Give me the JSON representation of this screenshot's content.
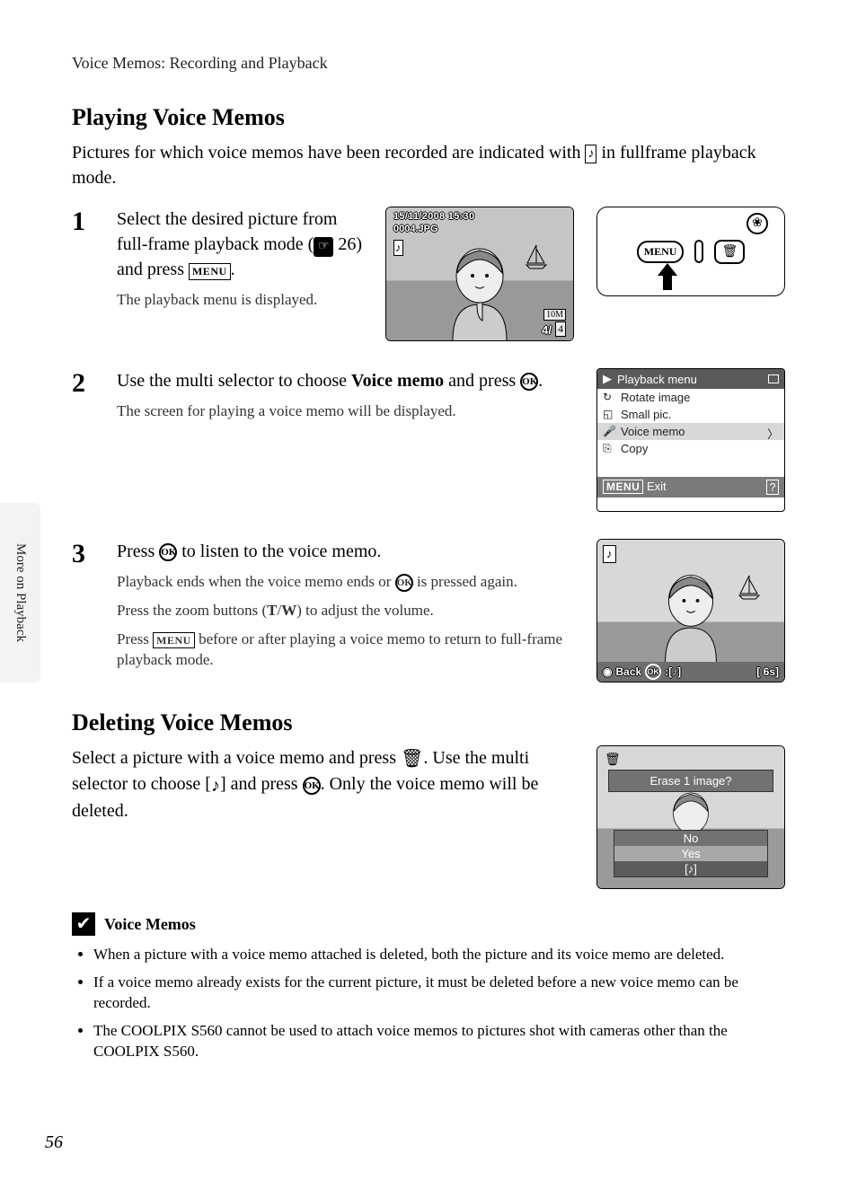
{
  "breadcrumb": "Voice Memos: Recording and Playback",
  "heading_play": "Playing Voice Memos",
  "intro_pre": "Pictures for which voice memos have been recorded are indicated with ",
  "intro_post": " in fullframe playback mode.",
  "step1": {
    "num": "1",
    "title_1": "Select the desired picture from full-frame playback mode (",
    "title_2": " 26) and press ",
    "title_3": ".",
    "sub": "The playback menu is displayed.",
    "lcd": {
      "date": "15/11/2008 15:30",
      "file": "0004.JPG",
      "counter": "4/",
      "total": "4",
      "res": "10M"
    }
  },
  "step2": {
    "num": "2",
    "title_1": "Use the multi selector to choose ",
    "title_bold": "Voice memo",
    "title_2": " and press ",
    "title_3": ".",
    "sub": "The screen for playing a voice memo will be displayed.",
    "menu": {
      "title": "Playback menu",
      "items": [
        {
          "label": "Rotate image",
          "icon": "↻"
        },
        {
          "label": "Small pic.",
          "icon": "◱"
        },
        {
          "label": "Voice memo",
          "icon": "🎤",
          "selected": true
        },
        {
          "label": "Copy",
          "icon": "⎘"
        }
      ],
      "exit": "Exit"
    }
  },
  "step3": {
    "num": "3",
    "title_1": "Press ",
    "title_2": " to listen to the voice memo.",
    "sub1_a": "Playback ends when the voice memo ends or ",
    "sub1_b": " is pressed again.",
    "sub2_a": "Press the zoom buttons (",
    "sub2_t": "T",
    "sub2_slash": "/",
    "sub2_w": "W",
    "sub2_b": ") to adjust the volume.",
    "sub3_a": "Press ",
    "sub3_b": " before or after playing a voice memo to return to full-frame playback mode.",
    "lcd": {
      "back": "Back",
      "time": "6s"
    }
  },
  "heading_delete": "Deleting Voice Memos",
  "delete_para_1": "Select a picture with a voice memo and press ",
  "delete_para_2": ". Use the multi selector to choose [",
  "delete_para_3": "] and press ",
  "delete_para_4": ". Only the voice memo will be deleted.",
  "erase_dlg": {
    "title": "Erase 1 image?",
    "no": "No",
    "yes": "Yes"
  },
  "note": {
    "title": "Voice Memos",
    "items": [
      "When a picture with a voice memo attached is deleted, both the picture and its voice memo are deleted.",
      "If a voice memo already exists for the current picture, it must be deleted before a new voice memo can be recorded.",
      "The COOLPIX S560 cannot be used to attach voice memos to pictures shot with cameras other than the COOLPIX S560."
    ]
  },
  "side_tab": "More on Playback",
  "page_number": "56",
  "labels": {
    "menu": "MENU",
    "ok": "OK"
  }
}
